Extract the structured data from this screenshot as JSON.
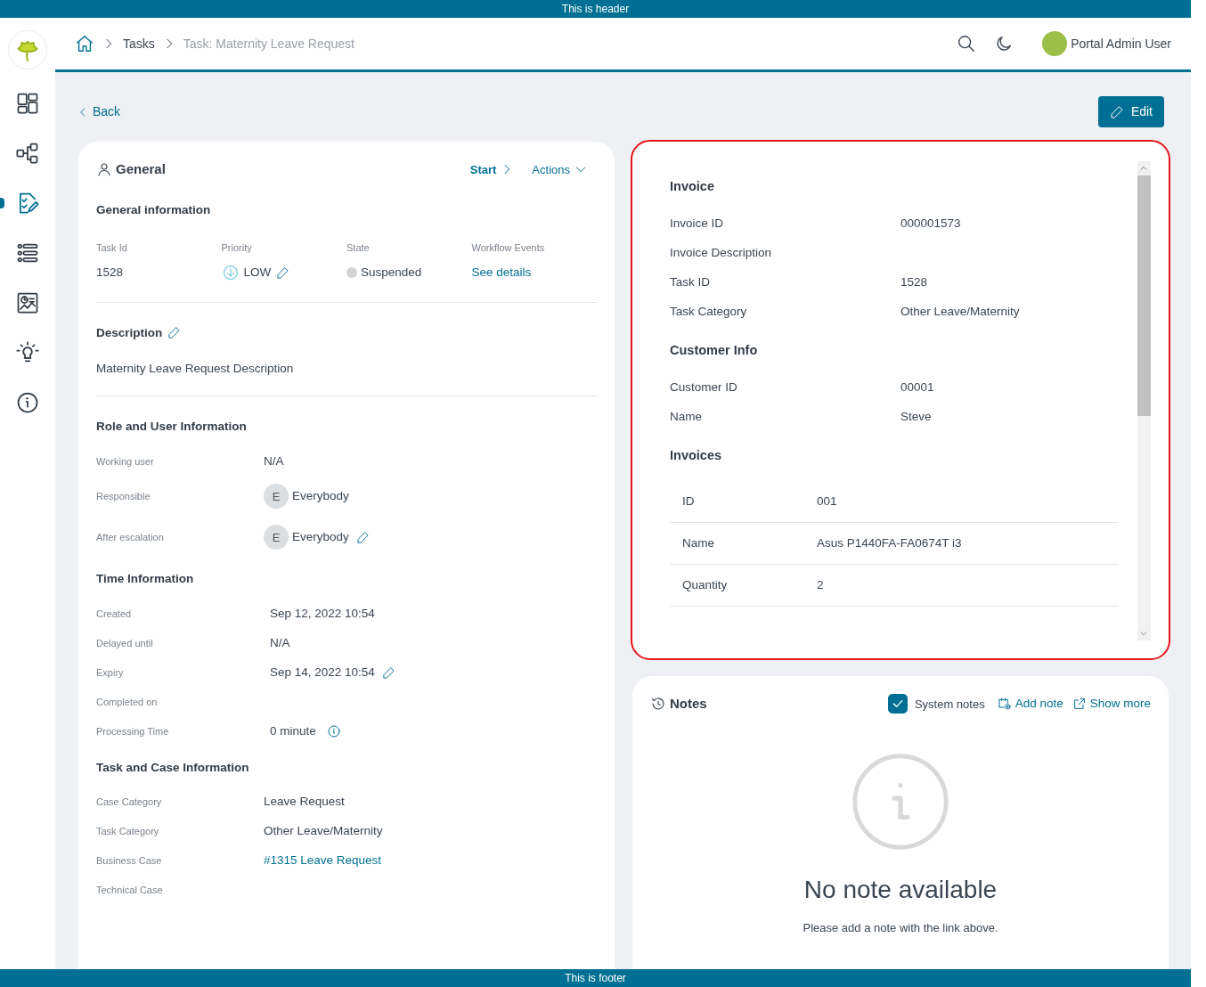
{
  "header_banner": "This is header",
  "sidebar": {
    "items": [
      {
        "kind": "dashboard",
        "selected": false
      },
      {
        "kind": "process",
        "selected": false
      },
      {
        "kind": "tasks",
        "selected": true
      },
      {
        "kind": "cases",
        "selected": false
      },
      {
        "kind": "statistics",
        "selected": false
      },
      {
        "kind": "ideas",
        "selected": false
      },
      {
        "kind": "about",
        "selected": false
      }
    ]
  },
  "breadcrumb": [
    {
      "label": "Tasks",
      "current": false
    },
    {
      "label": "Task: Maternity Leave Request",
      "current": true
    }
  ],
  "user": {
    "name": "Portal Admin User"
  },
  "back": "Back",
  "edit": "Edit",
  "general": {
    "title": "General",
    "start": "Start",
    "actions": "Actions",
    "info_title": "General information",
    "info": [
      {
        "label": "Task Id",
        "value": "1528",
        "kind": "text"
      },
      {
        "label": "Priority",
        "value": "LOW",
        "kind": "priority"
      },
      {
        "label": "State",
        "value": "Suspended",
        "kind": "state"
      },
      {
        "label": "Workflow Events",
        "value": "See details",
        "kind": "link"
      }
    ],
    "description": {
      "title": "Description",
      "text": "Maternity Leave Request Description"
    },
    "sections": [
      {
        "title": "Role and User Information",
        "rows": [
          {
            "label": "Working user",
            "value": "N/A",
            "kind": "text",
            "editable": false
          },
          {
            "label": "Responsible",
            "value": "Everybody",
            "initial": "E",
            "kind": "user",
            "editable": false
          },
          {
            "label": "After escalation",
            "value": "Everybody",
            "initial": "E",
            "kind": "user",
            "editable": true
          }
        ]
      },
      {
        "title": "Time Information",
        "rows": [
          {
            "label": "Created",
            "value": "Sep 12, 2022 10:54",
            "kind": "text",
            "editable": false
          },
          {
            "label": "Delayed until",
            "value": "N/A",
            "kind": "text",
            "editable": false
          },
          {
            "label": "Expiry",
            "value": "Sep 14, 2022 10:54",
            "kind": "text",
            "editable": true
          },
          {
            "label": "Completed on",
            "kind": "text",
            "editable": false
          },
          {
            "label": "Processing Time",
            "value": "0 minute",
            "kind": "info",
            "editable": false
          }
        ]
      },
      {
        "title": "Task and Case Information",
        "rows": [
          {
            "label": "Case Category",
            "value": "Leave Request",
            "kind": "text",
            "editable": false
          },
          {
            "label": "Task Category",
            "value": "Other Leave/Maternity",
            "kind": "text",
            "editable": false
          },
          {
            "label": "Business Case",
            "value": "#1315 Leave Request",
            "kind": "link",
            "editable": false
          },
          {
            "label": "Technical Case",
            "kind": "text",
            "editable": false
          }
        ]
      }
    ]
  },
  "invoice_panel": {
    "sections": [
      {
        "title": "Invoice",
        "kind": "fields",
        "rows": [
          {
            "label": "Invoice ID",
            "value": "000001573"
          },
          {
            "label": "Invoice Description"
          },
          {
            "label": "Task ID",
            "value": "1528"
          },
          {
            "label": "Task Category",
            "value": "Other Leave/Maternity"
          }
        ]
      },
      {
        "title": "Customer Info",
        "kind": "fields",
        "rows": [
          {
            "label": "Customer ID",
            "value": "00001"
          },
          {
            "label": "Name",
            "value": "Steve"
          }
        ]
      },
      {
        "title": "Invoices",
        "kind": "table",
        "rows": [
          {
            "label": "ID",
            "value": "001"
          },
          {
            "label": "Name",
            "value": "Asus P1440FA-FA0674T i3"
          },
          {
            "label": "Quantity",
            "value": "2"
          }
        ]
      }
    ]
  },
  "notes": {
    "title": "Notes",
    "system_notes": {
      "label": "System notes",
      "checked": true
    },
    "add_note": "Add note",
    "show_more": "Show more",
    "empty_title": "No note available",
    "empty_text": "Please add a note with the link above."
  },
  "footer_banner": "This is footer"
}
